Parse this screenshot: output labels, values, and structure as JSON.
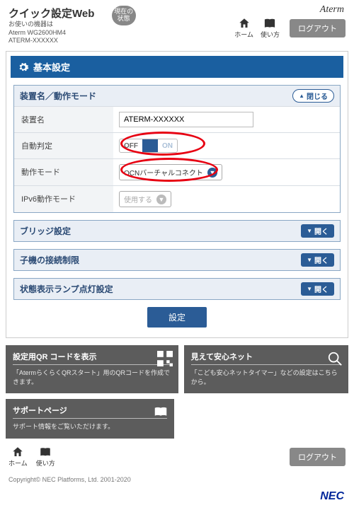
{
  "header": {
    "app_title": "クイック設定Web",
    "device_sub_label": "お使いの機器は",
    "device_model": "Aterm WG2600HM4",
    "device_id": "ATERM-XXXXXX",
    "status_btn": "現在の\n状態",
    "home_label": "ホーム",
    "howto_label": "使い方",
    "logout": "ログアウト",
    "brand": "Aterm"
  },
  "section_title": "基本設定",
  "panel1": {
    "title": "装置名／動作モード",
    "close_label": "閉じる",
    "rows": {
      "device_name_label": "装置名",
      "device_name_value": "ATERM-XXXXXX",
      "auto_detect_label": "自動判定",
      "toggle_off": "OFF",
      "toggle_on": "ON",
      "op_mode_label": "動作モード",
      "op_mode_value": "OCNバーチャルコネクト",
      "ipv6_label": "IPv6動作モード",
      "ipv6_value": "使用する"
    }
  },
  "collapsed": {
    "bridge": "ブリッジ設定",
    "child_limit": "子機の接続制限",
    "led": "状態表示ランプ点灯設定",
    "open_label": "開く"
  },
  "apply_btn": "設定",
  "cards": {
    "qr_title": "設定用QR コードを表示",
    "qr_body": "「AtermらくらくQRスタート」用のQRコードを作成できます。",
    "safe_title": "見えて安心ネット",
    "safe_body": "「こども安心ネットタイマー」などの設定はこちらから。",
    "support_title": "サポートページ",
    "support_body": "サポート情報をご覧いただけます。"
  },
  "footer": {
    "home_label": "ホーム",
    "howto_label": "使い方",
    "logout": "ログアウト",
    "copyright": "Copyright© NEC Platforms, Ltd. 2001-2020",
    "nec": "NEC"
  }
}
